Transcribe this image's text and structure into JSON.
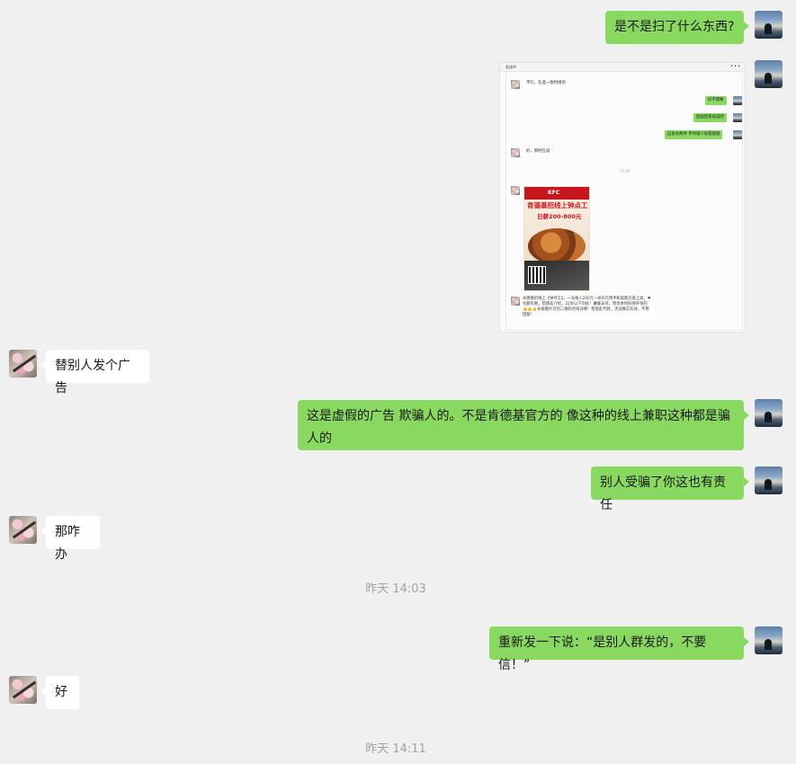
{
  "messages": [
    {
      "side": "me",
      "text": "是不是扫了什么东西?"
    },
    {
      "side": "me",
      "type": "image",
      "embedded": {
        "header": "发送中",
        "menu": "•••",
        "rows": [
          {
            "side": "other",
            "text": "不行，在选一款时尚的"
          },
          {
            "side": "me",
            "text": "好不需要"
          },
          {
            "side": "me",
            "text": "后面回来再说吧"
          },
          {
            "side": "me",
            "text": "这会有两件 平时很少穿搭链接"
          },
          {
            "side": "other",
            "text": "好，到时在说"
          }
        ],
        "time": "15:56",
        "poster": {
          "brand": "KFC",
          "headline": "肯德基招线上钟点工",
          "pay": "日薪200-800元"
        },
        "long_text": "肯德基招线上【钟点工】，一天收入200元—800元用手机就能在家上班。❤名额有限，帮朋友介绍，22岁以下勿扰！薯康支持，赞金余时间挣外快的👍👍👍长按图片识别二维码咨询详情！帮朋友代转，活动真实有效，不用回复！"
      }
    },
    {
      "side": "other",
      "text": "替别人发个广告"
    },
    {
      "side": "me",
      "text": "这是虚假的广告 欺骗人的。不是肯德基官方的 像这种的线上兼职这种都是骗人的"
    },
    {
      "side": "me",
      "text": "别人受骗了你这也有责任"
    },
    {
      "side": "other",
      "text": "那咋办"
    },
    {
      "type": "time",
      "text": "昨天 14:03"
    },
    {
      "side": "me",
      "text": "重新发一下说：“是别人群发的，不要信！”"
    },
    {
      "side": "other",
      "text": "好"
    },
    {
      "type": "time",
      "text": "昨天 14:11"
    }
  ]
}
